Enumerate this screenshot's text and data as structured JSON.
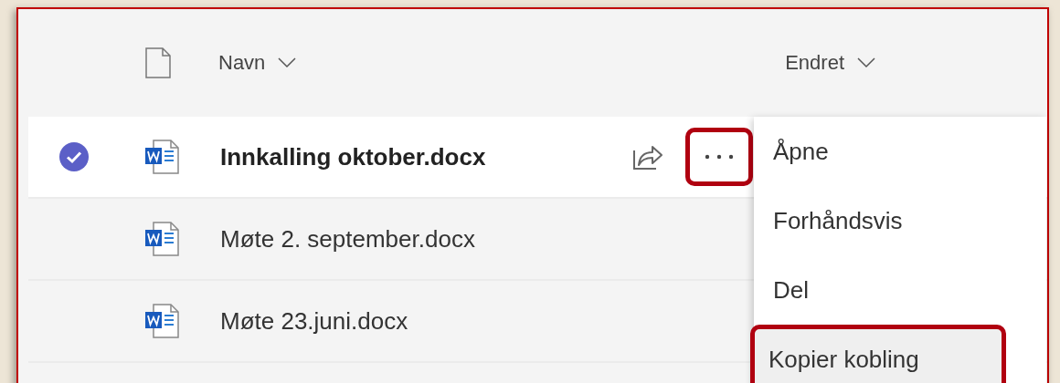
{
  "columns": [
    {
      "label": "Navn"
    },
    {
      "label": "Endret"
    }
  ],
  "files": [
    {
      "name": "Innkalling oktober.docx",
      "selected": true
    },
    {
      "name": "Møte 2. september.docx",
      "selected": false
    },
    {
      "name": "Møte 23.juni.docx",
      "selected": false
    }
  ],
  "more_button": {
    "highlighted": true
  },
  "menu": {
    "items": [
      {
        "label": "Åpne",
        "hovered": false,
        "highlighted": false
      },
      {
        "label": "Forhåndsvis",
        "hovered": false,
        "highlighted": false
      },
      {
        "label": "Del",
        "hovered": false,
        "highlighted": false
      },
      {
        "label": "Kopier kobling",
        "hovered": true,
        "highlighted": true
      }
    ]
  }
}
